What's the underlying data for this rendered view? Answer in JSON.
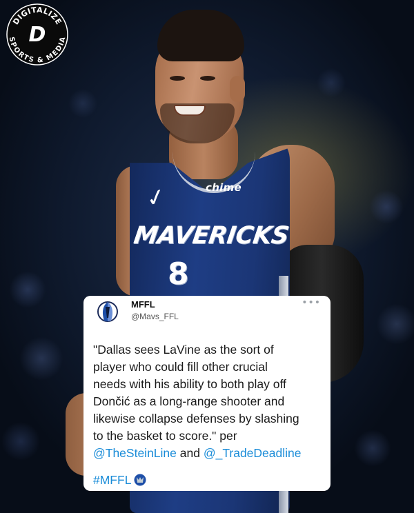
{
  "image": {
    "brand": {
      "arc_top_text": "DIGITALIZE",
      "arc_bottom_text": "SPORTS & MEDIA",
      "monogram": "D",
      "icon": "digitalize-sports-media-logo"
    },
    "jersey": {
      "sponsor": "chime",
      "wordmark": "MAVERICKS",
      "number": "8"
    }
  },
  "tweet": {
    "display_name": "MFFL",
    "handle": "@Mavs_FFL",
    "more_icon": "ellipsis-icon",
    "text_lines": [
      "\"Dallas sees LaVine as the sort of",
      "player who could fill other crucial",
      "needs with his ability to both play off",
      "Dončić as a long-range shooter and",
      "likewise collapse defenses by slashing",
      "to the basket to score.\" per"
    ],
    "mention_1": "@TheSteinLine",
    "connector": " and ",
    "mention_2": "@_TradeDeadline",
    "hashtag": "#MFFL",
    "hashtag_icon": "mavericks-logo-icon"
  },
  "colors": {
    "link": "#1a8cd8",
    "card_bg": "#ffffff",
    "jersey_blue": "#1e3d84"
  }
}
